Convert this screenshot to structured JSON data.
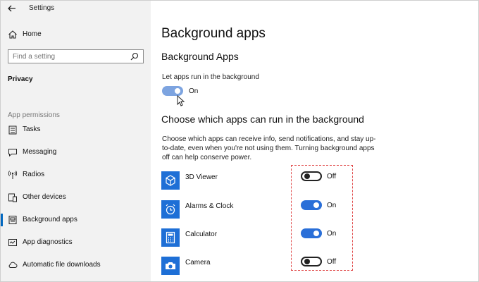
{
  "window": {
    "title": "Settings"
  },
  "sidebar": {
    "home_label": "Home",
    "search": {
      "placeholder": "Find a setting"
    },
    "section_title": "Privacy",
    "group_label": "App permissions",
    "items": [
      {
        "label": "Tasks",
        "icon": "tasks-icon"
      },
      {
        "label": "Messaging",
        "icon": "messaging-icon"
      },
      {
        "label": "Radios",
        "icon": "radios-icon"
      },
      {
        "label": "Other devices",
        "icon": "other-devices-icon"
      },
      {
        "label": "Background apps",
        "icon": "background-apps-icon",
        "active": true
      },
      {
        "label": "App diagnostics",
        "icon": "app-diagnostics-icon"
      },
      {
        "label": "Automatic file downloads",
        "icon": "cloud-download-icon"
      }
    ]
  },
  "main": {
    "page_title": "Background apps",
    "section_heading": "Background Apps",
    "master_toggle": {
      "label": "Let apps run in the background",
      "state": "On"
    },
    "choose_heading": "Choose which apps can run in the background",
    "description": "Choose which apps can receive info, send notifications, and stay up-to-date, even when you're not using them. Turning background apps off can help conserve power.",
    "apps": [
      {
        "name": "3D Viewer",
        "state": "Off",
        "icon": "cube-icon"
      },
      {
        "name": "Alarms & Clock",
        "state": "On",
        "icon": "alarm-clock-icon"
      },
      {
        "name": "Calculator",
        "state": "On",
        "icon": "calculator-icon"
      },
      {
        "name": "Camera",
        "state": "Off",
        "icon": "camera-icon"
      }
    ]
  },
  "colors": {
    "accent": "#2a6fd8",
    "sidebar_bg": "#f2f2f2",
    "highlight_border": "#e04848"
  }
}
